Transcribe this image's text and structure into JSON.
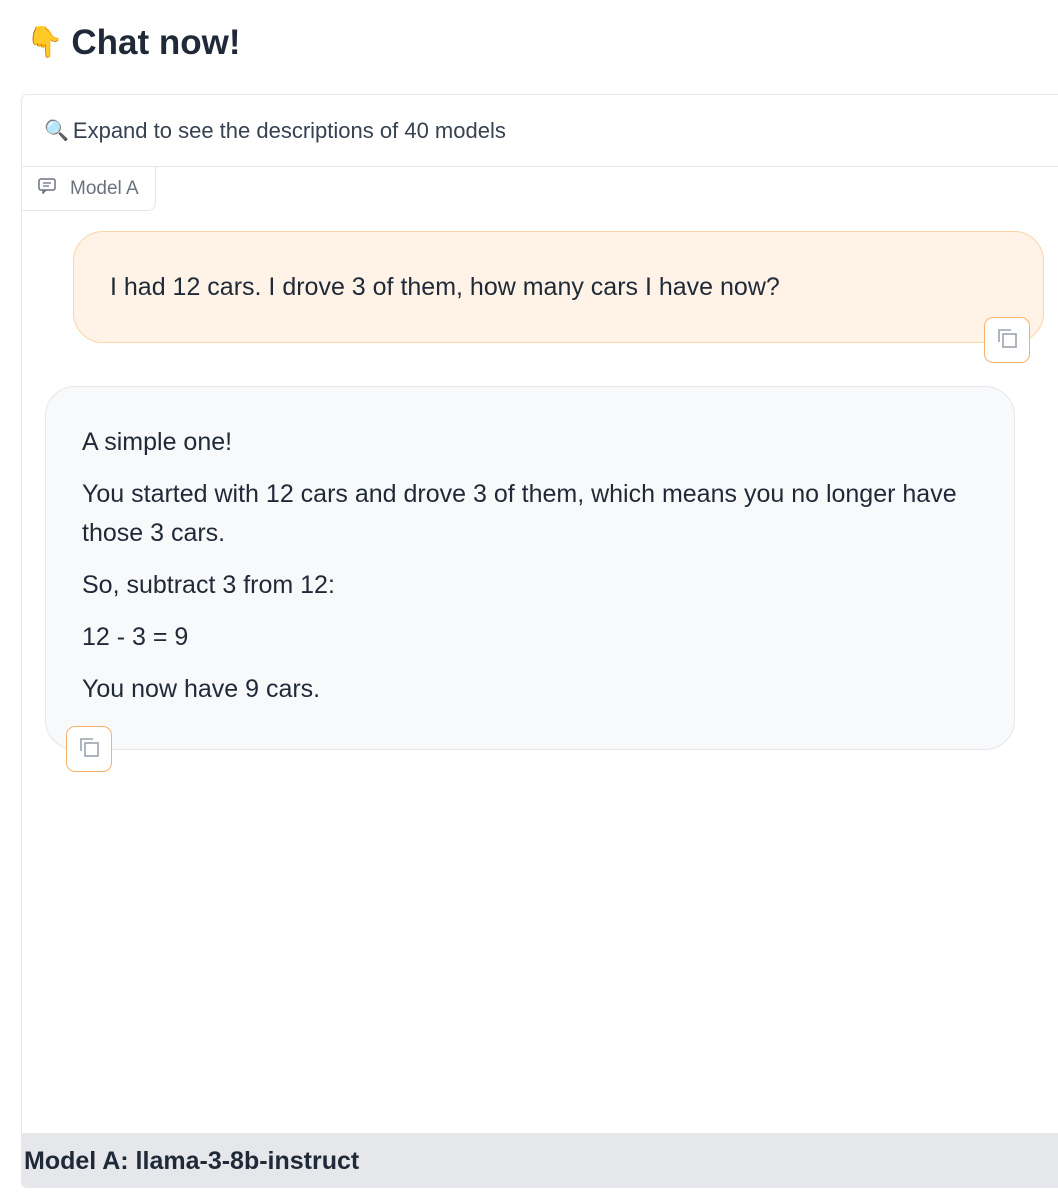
{
  "header": {
    "icon": "pointing-down-hand-icon",
    "icon_glyph": "👇",
    "title": "Chat now!"
  },
  "accordion": {
    "icon": "magnifier-icon",
    "icon_glyph": "🔍",
    "label": "Expand to see the descriptions of 40 models"
  },
  "chatbot": {
    "label": "Model A",
    "label_icon": "chat-icon",
    "messages": [
      {
        "role": "user",
        "text": "I had 12 cars. I drove 3 of them, how many cars I have now?"
      },
      {
        "role": "assistant",
        "paragraphs": [
          "A simple one!",
          "You started with 12 cars and drove 3 of them, which means you no longer have those 3 cars.",
          "So, subtract 3 from 12:",
          "12 - 3 = 9",
          "You now have 9 cars."
        ]
      }
    ]
  },
  "footer": {
    "model_name": "Model A: llama-3-8b-instruct"
  },
  "colors": {
    "user_bubble_bg": "#fef3e6",
    "user_bubble_border": "#fbd5a5",
    "copy_button_border": "#f6b26b",
    "bot_bubble_bg": "#f8f9fb",
    "footer_bg": "#e5e7eb"
  }
}
